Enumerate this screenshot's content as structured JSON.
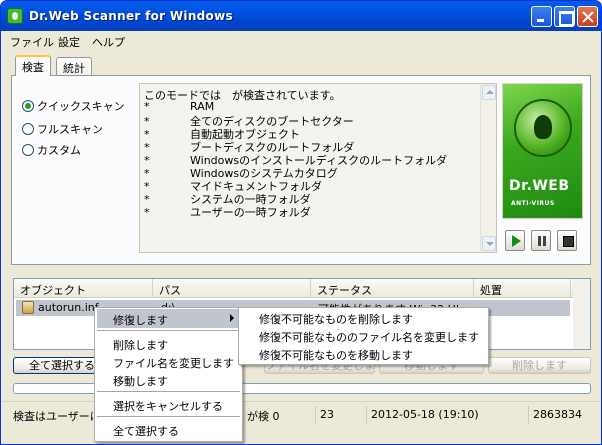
{
  "window": {
    "title": "Dr.Web Scanner for Windows"
  },
  "menu": [
    "ファイル",
    "設定",
    "ヘルプ"
  ],
  "tabs": [
    {
      "label": "検査",
      "active": true
    },
    {
      "label": "統計",
      "active": false
    }
  ],
  "scan_modes": [
    {
      "label": "クイックスキャン",
      "selected": true
    },
    {
      "label": "フルスキャン",
      "selected": false
    },
    {
      "label": "カスタム",
      "selected": false
    }
  ],
  "description": {
    "header": "このモードでは　が検査されています。",
    "bullet": "*",
    "items": [
      "RAM",
      "全てのディスクのブートセクター",
      "自動起動オブジェクト",
      "ブートディスクのルートフォルダ",
      "Windowsのインストールディスクのルートフォルダ",
      "Windowsのシステムカタログ",
      "マイドキュメントフォルダ",
      "システムの一時フォルダ",
      "ユーザーの一時フォルダ"
    ]
  },
  "logo": {
    "brand": "Dr.WEB",
    "sub": "ANTI-VIRUS"
  },
  "controls": [
    "play-icon",
    "pause-icon",
    "stop-icon"
  ],
  "results": {
    "columns": [
      "オブジェクト",
      "パス",
      "ステータス",
      "処置"
    ],
    "rows": [
      {
        "object": "autorun.inf",
        "path": "d:\\",
        "status": "可能性があります Win32.HL",
        "action": ""
      }
    ]
  },
  "buttons": {
    "select_all": "全て選択する",
    "rename": "ファイル名を変更します",
    "move": "移動します",
    "delete": "削除します"
  },
  "status": {
    "message": "検査はユーザーによって中断されました",
    "checked_label": "が検",
    "checked_count": "0",
    "cell2": "23",
    "datetime": "2012-05-18 (19:10)",
    "cell4": "2863834"
  },
  "context_menu": {
    "items": [
      "修復します",
      "削除します",
      "ファイル名を変更します",
      "移動します",
      "選択をキャンセルする",
      "全て選択する"
    ]
  },
  "submenu": {
    "items": [
      "修復不可能なものを削除します",
      "修復不可能なもののファイル名を変更します",
      "修復不可能なものを移動します"
    ]
  }
}
